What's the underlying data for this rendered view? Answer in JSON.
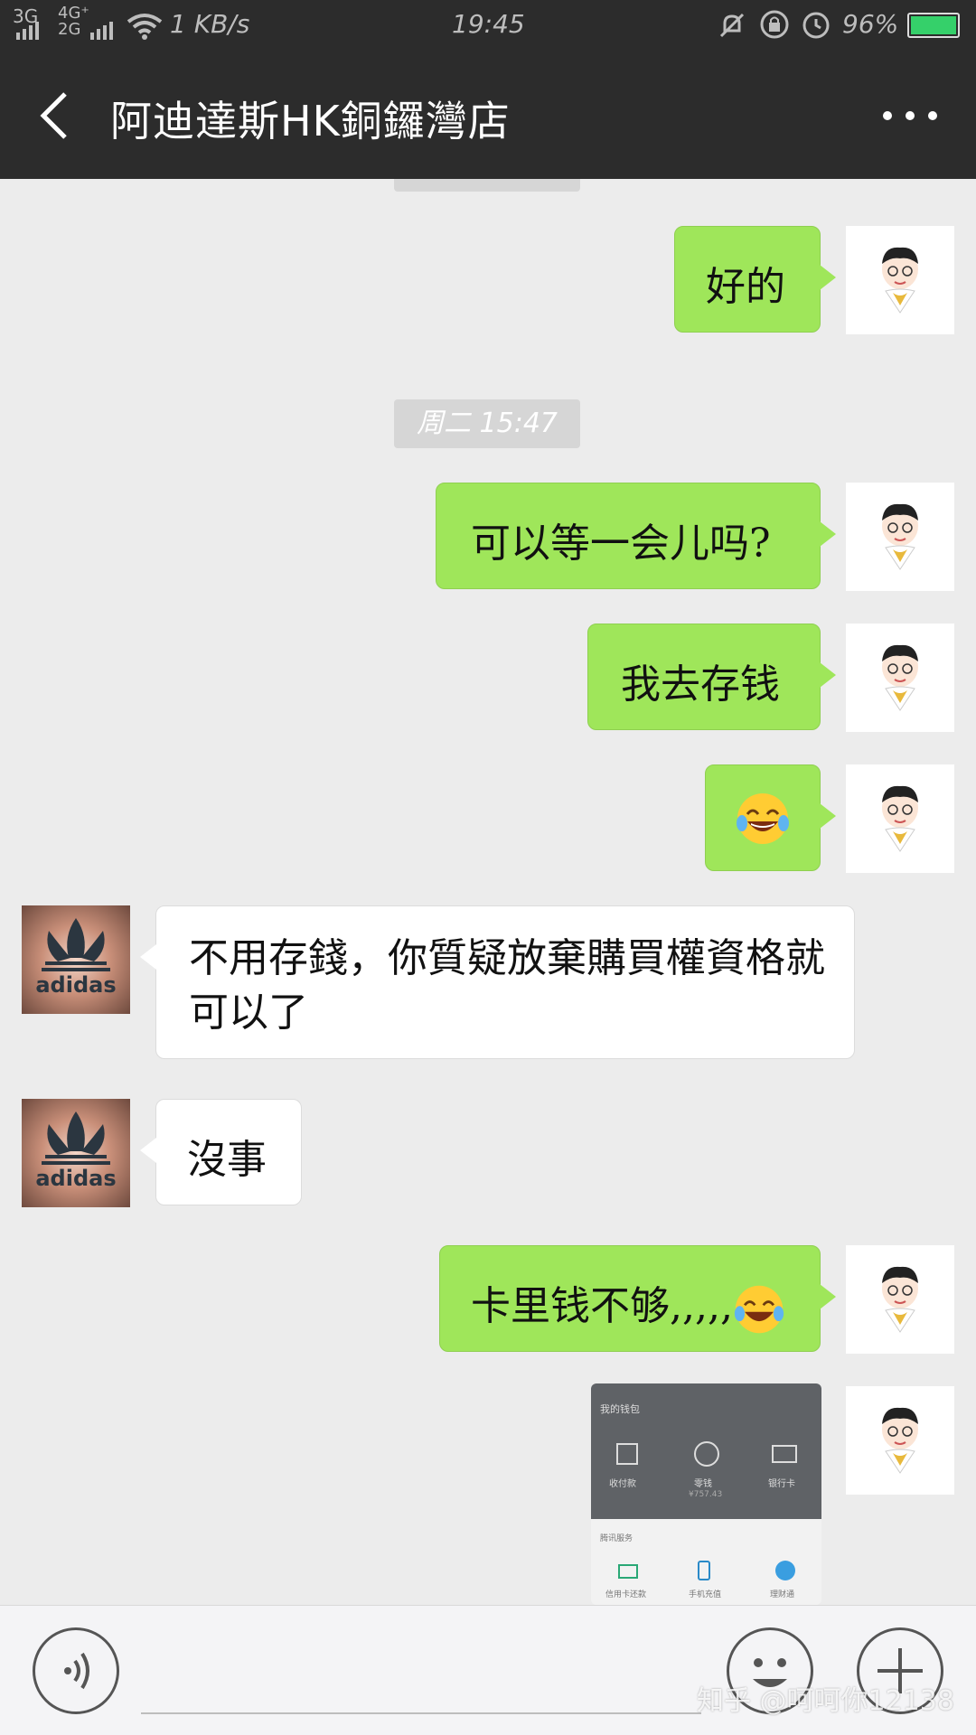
{
  "status_bar": {
    "network_1": "3G",
    "network_2": "4G⁺ 2G",
    "speed": "1 KB/s",
    "time": "19:45",
    "battery": "96%",
    "battery_color": "#35d06a"
  },
  "header": {
    "title": "阿迪達斯HK銅鑼灣店",
    "back_icon": "chevron-left-icon",
    "more_icon": "more-horizontal-icon"
  },
  "timestamps": {
    "partial": "",
    "t1": "周二 15:47"
  },
  "messages": [
    {
      "from": "me",
      "text": "好的"
    },
    {
      "from": "me",
      "text": "可以等一会儿吗?"
    },
    {
      "from": "me",
      "text": "我去存钱"
    },
    {
      "from": "me",
      "emoji": "face-with-tears-of-joy"
    },
    {
      "from": "shop",
      "text": "不用存錢，你質疑放棄購買權資格就可以了"
    },
    {
      "from": "shop",
      "text": "沒事"
    },
    {
      "from": "me",
      "text": "卡里钱不够,,,,,",
      "emoji": "face-with-tears-of-joy"
    },
    {
      "from": "me",
      "type": "image",
      "image": {
        "title": "我的钱包",
        "icons": [
          "收付款",
          "零钱",
          "银行卡"
        ],
        "sub_value": "¥757.43",
        "section": "腾讯服务",
        "services": [
          "信用卡还款",
          "手机充值",
          "理财通"
        ]
      }
    }
  ],
  "avatars": {
    "shop_brand": "adidas",
    "me_icon": "cartoon-boy-avatar-icon"
  },
  "input_bar": {
    "voice_icon": "voice-icon",
    "emoji_icon": "smiley-icon",
    "plus_icon": "plus-icon",
    "watermark": "知乎 @呵呵你12138"
  },
  "colors": {
    "bubble_me": "#9fe65a",
    "bubble_other": "#ffffff",
    "header_bg": "#2c2c2c",
    "chat_bg": "#ececec"
  }
}
